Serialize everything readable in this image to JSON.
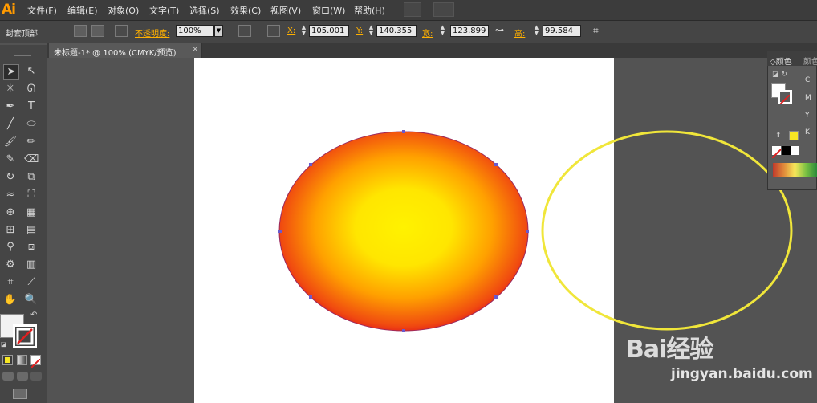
{
  "app": {
    "logo": "Ai"
  },
  "menu": [
    "文件(F)",
    "编辑(E)",
    "对象(O)",
    "文字(T)",
    "选择(S)",
    "效果(C)",
    "视图(V)",
    "窗口(W)",
    "帮助(H)"
  ],
  "control_bar": {
    "selection_label": "封套顶部",
    "opacity_label": "不透明度:",
    "opacity_value": "100%",
    "x_label": "X:",
    "x_value": "105.001",
    "y_label": "Y:",
    "y_value": "140.355",
    "w_label": "宽:",
    "w_value": "123.899",
    "h_label": "高:",
    "h_value": "99.584"
  },
  "document_tab": {
    "title": "未标题-1* @ 100% (CMYK/预览)",
    "close": "×"
  },
  "color_panel": {
    "tabs": [
      "颜色",
      "颜色"
    ],
    "channels": [
      "C",
      "M",
      "Y",
      "K"
    ],
    "fill_color": "#ffffff",
    "selected_swatch": "#f6e623"
  },
  "artwork": {
    "gradient_inner": "#fff200",
    "gradient_outer": "#e0101d",
    "outline_color": "#f0e63a"
  },
  "watermark": {
    "brand": "Bai经验",
    "url": "jingyan.baidu.com"
  }
}
